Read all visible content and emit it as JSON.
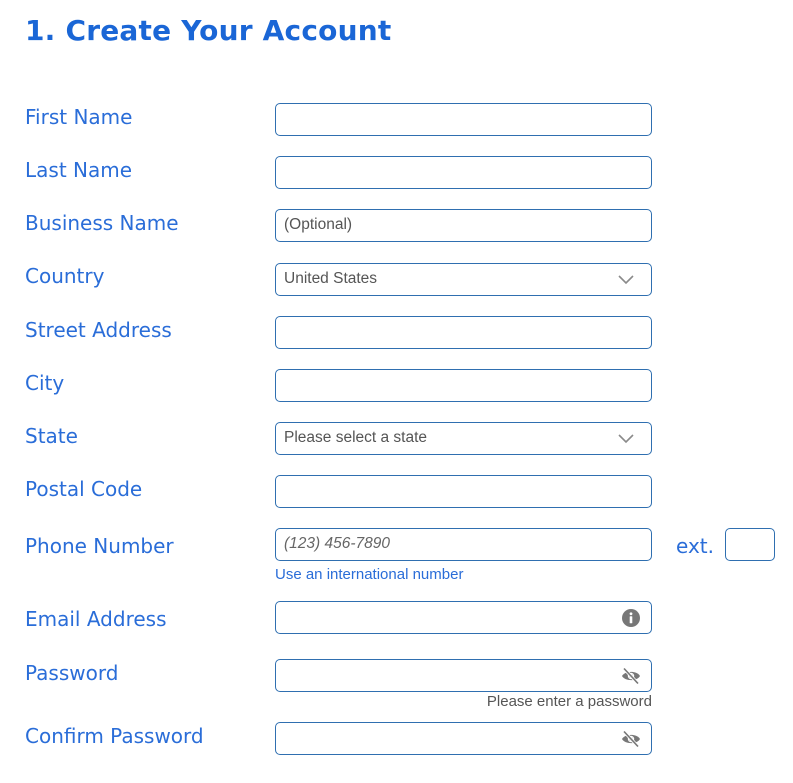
{
  "form": {
    "title": "1. Create Your Account",
    "fields": {
      "first_name": {
        "label": "First Name",
        "value": ""
      },
      "last_name": {
        "label": "Last Name",
        "value": ""
      },
      "business_name": {
        "label": "Business Name",
        "placeholder": "(Optional)"
      },
      "country": {
        "label": "Country",
        "selected": "United States",
        "icon": "chevron-down-icon"
      },
      "street_address": {
        "label": "Street Address",
        "value": ""
      },
      "city": {
        "label": "City",
        "value": ""
      },
      "state": {
        "label": "State",
        "selected": "Please select a state",
        "icon": "chevron-down-icon"
      },
      "postal_code": {
        "label": "Postal Code",
        "value": ""
      },
      "phone_number": {
        "label": "Phone Number",
        "placeholder": "(123) 456-7890",
        "ext_label": "ext.",
        "ext_value": "",
        "helper_link": "Use an international number"
      },
      "email_address": {
        "label": "Email Address",
        "value": "",
        "icon": "info-icon"
      },
      "password": {
        "label": "Password",
        "value": "",
        "icon": "eye-slash-icon",
        "helper_text": "Please enter a password"
      },
      "confirm_password": {
        "label": "Confirm Password",
        "value": "",
        "icon": "eye-slash-icon"
      }
    }
  },
  "colors": {
    "heading": "#1a66d6",
    "label": "#2a6dd8",
    "border": "#2f6fb0",
    "text": "#555555",
    "icon": "#777777"
  }
}
